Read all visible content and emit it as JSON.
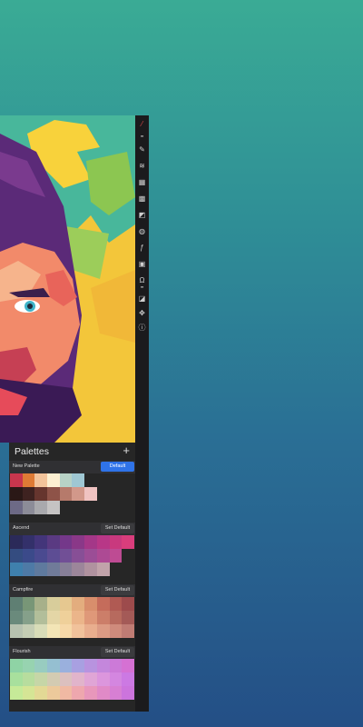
{
  "panel": {
    "title": "Palettes",
    "add_label": "+"
  },
  "palettes": [
    {
      "name": "New Palette",
      "button": "Default",
      "rows": [
        [
          "#c8364d",
          "#df7b35",
          "#f3c49b",
          "#fdf0d2",
          "#b7d2c6",
          "#9fc7d3",
          "",
          "",
          "",
          ""
        ],
        [
          "#2a1816",
          "#3e2220",
          "#66352e",
          "#8e5348",
          "#b67a6b",
          "#d2988a",
          "#f0c3c1",
          "",
          "",
          ""
        ],
        [
          "#6d6a86",
          "#8c8c98",
          "#a9a9ad",
          "#c5c3c3",
          "",
          "",
          "",
          "",
          "",
          ""
        ]
      ]
    },
    {
      "name": "Ascend",
      "button": "Set Default",
      "rows": [
        [
          "#2b2a59",
          "#33306a",
          "#43357a",
          "#5a3a82",
          "#74388a",
          "#8a3888",
          "#a43788",
          "#b83787",
          "#c9397e",
          "#d93d7c"
        ],
        [
          "#344c80",
          "#3b4a8a",
          "#4a4a90",
          "#5d4d94",
          "#714f96",
          "#874f96",
          "#9b4d96",
          "#ad4a94",
          "#be4b93",
          ""
        ],
        [
          "#3f80ad",
          "#4e7aa6",
          "#5f7a9e",
          "#707b99",
          "#877f98",
          "#9c869a",
          "#b0929f",
          "#c1a3aa",
          "",
          ""
        ]
      ]
    },
    {
      "name": "Campfire",
      "button": "Set Default",
      "rows": [
        [
          "#5f7f73",
          "#789677",
          "#a7b08a",
          "#d8cd9b",
          "#e6c890",
          "#e3ad7e",
          "#d88e6c",
          "#c56c5b",
          "#b05a53",
          "#9d4b4c"
        ],
        [
          "#6a8a7c",
          "#85a08a",
          "#b2be9a",
          "#e4d6a6",
          "#efd09a",
          "#ebb58a",
          "#df9879",
          "#cc7e69",
          "#b76a5e",
          "#a45a57"
        ],
        [
          "#b7c2b0",
          "#c4cdb4",
          "#d8dcb8",
          "#f3e5b6",
          "#f6d8a8",
          "#f1c29b",
          "#e9ae8e",
          "#dc9b84",
          "#cf8b7c",
          "#c07c74"
        ]
      ]
    },
    {
      "name": "Flourish",
      "button": "Set Default",
      "rows": [
        [
          "#8fd3a5",
          "#97d3b0",
          "#98ccc0",
          "#95bfd1",
          "#9ab0dd",
          "#a8a0e1",
          "#b893df",
          "#c487dc",
          "#cc7ad8",
          "#d571d3"
        ],
        [
          "#a8e09d",
          "#b7dd9e",
          "#c6d6a7",
          "#d3cbb2",
          "#dcc0bf",
          "#e1b4cb",
          "#e0a5d6",
          "#dc96dd",
          "#d486e0",
          "#cc79e3"
        ],
        [
          "#c6ea98",
          "#d5e595",
          "#e3d995",
          "#ecc99b",
          "#f0b9a3",
          "#eea7ae",
          "#e897bb",
          "#e08ac7",
          "#d77fd3",
          "#cc74dd"
        ]
      ]
    }
  ]
}
